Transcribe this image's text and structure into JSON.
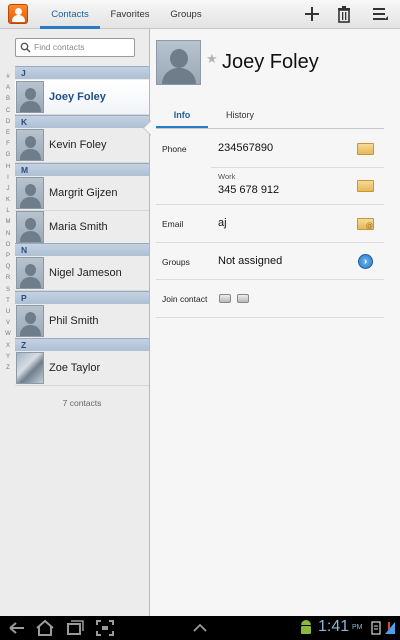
{
  "tabs": [
    {
      "label": "Contacts"
    },
    {
      "label": "Favorites"
    },
    {
      "label": "Groups"
    }
  ],
  "search": {
    "placeholder": "Find contacts"
  },
  "index_letters": [
    "#",
    "A",
    "B",
    "C",
    "D",
    "E",
    "F",
    "G",
    "H",
    "I",
    "J",
    "K",
    "L",
    "M",
    "N",
    "O",
    "P",
    "Q",
    "R",
    "S",
    "T",
    "U",
    "V",
    "W",
    "X",
    "Y",
    "Z"
  ],
  "sections": [
    {
      "letter": "J",
      "contacts": [
        "Joey Foley"
      ]
    },
    {
      "letter": "K",
      "contacts": [
        "Kevin Foley"
      ]
    },
    {
      "letter": "M",
      "contacts": [
        "Margrit Gijzen",
        "Maria Smith"
      ]
    },
    {
      "letter": "N",
      "contacts": [
        "Nigel Jameson"
      ]
    },
    {
      "letter": "P",
      "contacts": [
        "Phil Smith"
      ]
    },
    {
      "letter": "Z",
      "contacts": [
        "Zoe Taylor"
      ]
    }
  ],
  "contact_count": "7 contacts",
  "detail": {
    "name": "Joey Foley",
    "tabs": [
      {
        "label": "Info"
      },
      {
        "label": "History"
      }
    ],
    "phone_label": "Phone",
    "phone_value": "234567890",
    "work_label": "Work",
    "work_value": "345 678 912",
    "email_label": "Email",
    "email_value": "aj",
    "groups_label": "Groups",
    "groups_value": "Not assigned",
    "join_label": "Join contact"
  },
  "system": {
    "time": "1:41",
    "ampm": "PM"
  },
  "colors": {
    "accent": "#2a7bc4",
    "section": "#aebfd4",
    "message": "#e6b65a"
  }
}
